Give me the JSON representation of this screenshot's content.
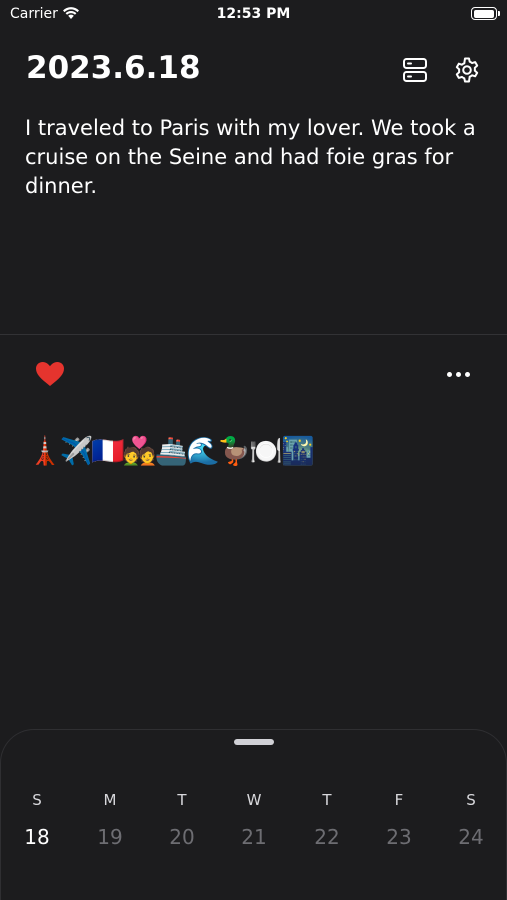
{
  "status_bar": {
    "carrier": "Carrier",
    "time": "12:53 PM"
  },
  "header": {
    "date": "2023.6.18",
    "list_icon": "server-stack-icon",
    "settings_icon": "gear-icon"
  },
  "entry": {
    "text": "I traveled to Paris with my lover. We took a cruise on the Seine and had foie gras for dinner.",
    "emojis": "🗼✈️🇫🇷💑🚢🌊🦆🍽️🌃",
    "liked": true,
    "heart_color": "#e5342e"
  },
  "calendar": {
    "weekdays": [
      "S",
      "M",
      "T",
      "W",
      "T",
      "F",
      "S"
    ],
    "days": [
      "18",
      "19",
      "20",
      "21",
      "22",
      "23",
      "24"
    ],
    "selected_day": "18",
    "accent": "#ef5a5f"
  }
}
